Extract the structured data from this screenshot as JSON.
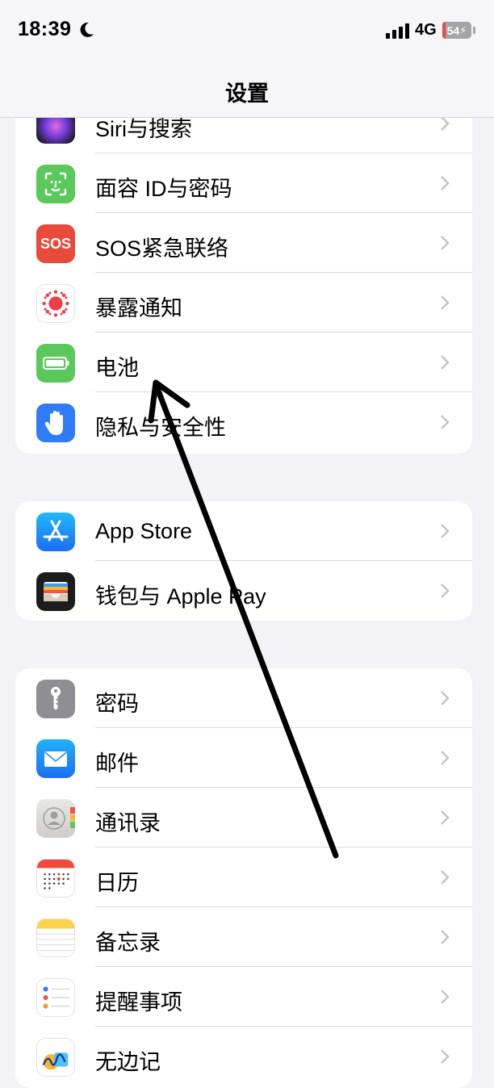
{
  "status_bar": {
    "time": "18:39",
    "network": "4G",
    "battery": "54"
  },
  "nav": {
    "title": "设置"
  },
  "groups": [
    [
      {
        "label": "Siri与搜索",
        "icon": "siri-icon"
      },
      {
        "label": "面容 ID与密码",
        "icon": "face-id-icon"
      },
      {
        "label": "SOS紧急联络",
        "icon": "sos-icon",
        "icon_text": "SOS"
      },
      {
        "label": "暴露通知",
        "icon": "exposure-icon"
      },
      {
        "label": "电池",
        "icon": "battery-icon"
      },
      {
        "label": "隐私与安全性",
        "icon": "hand-icon"
      }
    ],
    [
      {
        "label": "App Store",
        "icon": "app-store-icon"
      },
      {
        "label": "钱包与 Apple Pay",
        "icon": "wallet-icon"
      }
    ],
    [
      {
        "label": "密码",
        "icon": "key-icon"
      },
      {
        "label": "邮件",
        "icon": "mail-icon"
      },
      {
        "label": "通讯录",
        "icon": "contacts-icon"
      },
      {
        "label": "日历",
        "icon": "calendar-icon"
      },
      {
        "label": "备忘录",
        "icon": "notes-icon"
      },
      {
        "label": "提醒事项",
        "icon": "reminders-icon"
      },
      {
        "label": "无边记",
        "icon": "freeform-icon"
      }
    ]
  ],
  "colors": {
    "face_id": "#5ac85a",
    "sos": "#e84a3c",
    "battery": "#5ac85a",
    "privacy": "#2f7cf6",
    "app_store": "#1d8cf5",
    "key": "#8e8e93",
    "mail": "#1f8cf7"
  }
}
